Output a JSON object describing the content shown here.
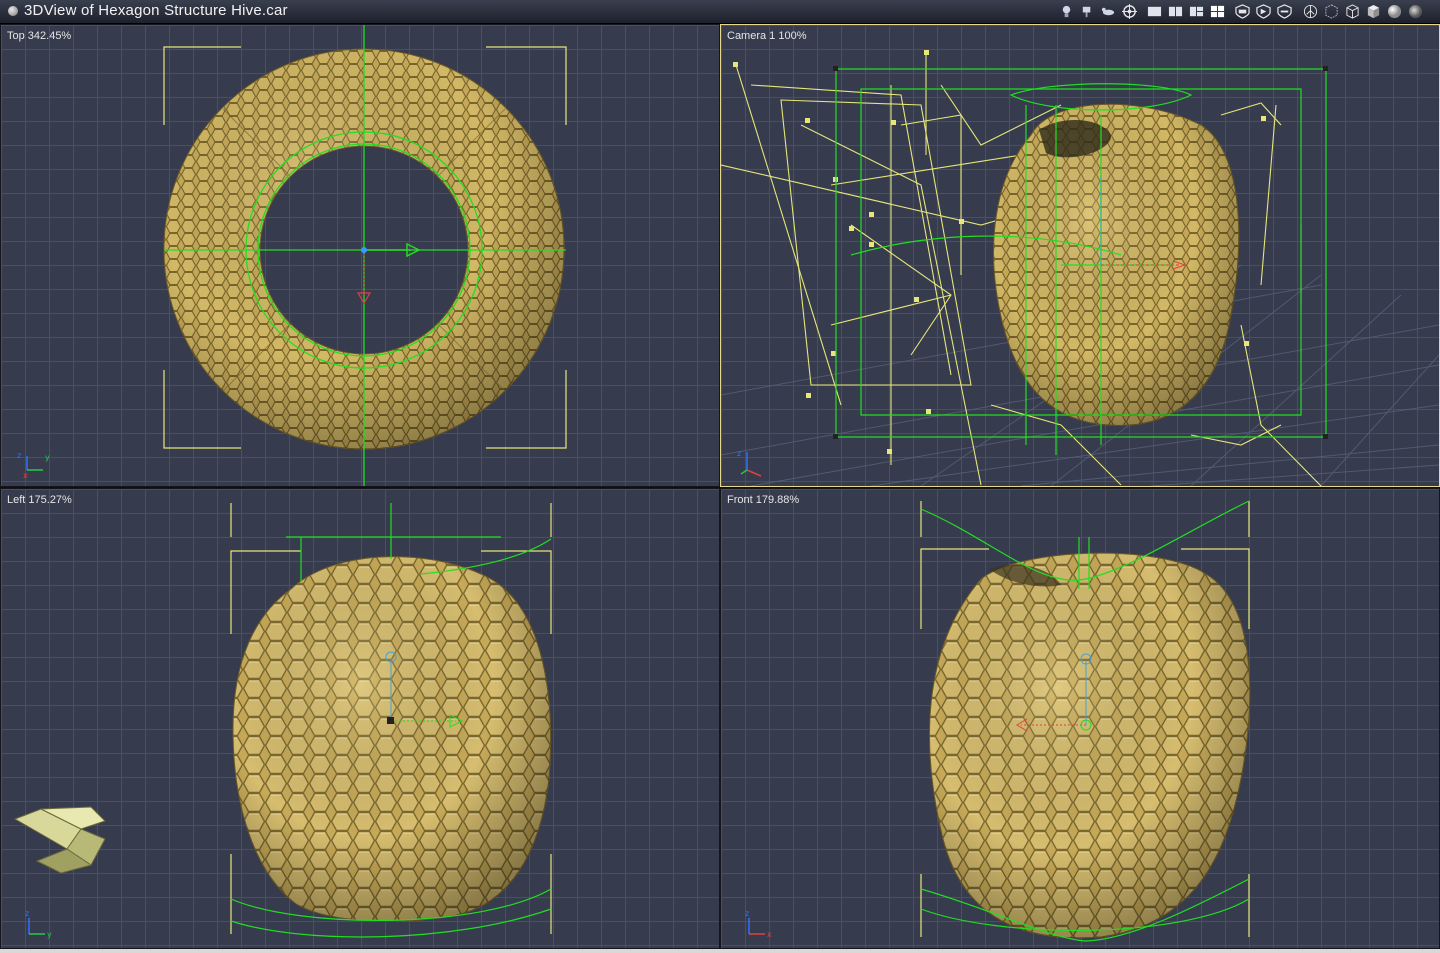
{
  "window": {
    "title": "3DView of Hexagon Structure Hive.car"
  },
  "toolbar": {
    "tool_icons": [
      "light-icon",
      "camera-icon",
      "animal-icon",
      "target-icon"
    ],
    "layout_icons": [
      "layout-single-icon",
      "layout-two-icon",
      "layout-three-icon",
      "layout-four-icon"
    ],
    "view_icons": [
      "shield-front-icon",
      "shield-side-icon",
      "shield-top-icon"
    ],
    "render_icons": [
      "axis-icon",
      "bounding-box-icon",
      "wireframe-cube-icon",
      "solid-cube-icon",
      "smooth-sphere-icon",
      "shaded-sphere-icon"
    ]
  },
  "viewports": {
    "top": {
      "label": "Top 342.45%"
    },
    "camera": {
      "label": "Camera 1 100%"
    },
    "left": {
      "label": "Left 175.27%"
    },
    "front": {
      "label": "Front 179.88%"
    }
  },
  "axes": {
    "x": "x",
    "y": "y",
    "z": "z"
  },
  "colors": {
    "viewport_bg": "#363b4e",
    "grid": "#4a5063",
    "object_fill": "#c9ad5c",
    "selection_green": "#22dd22",
    "bounds_yellow": "#e6e67a",
    "active_border": "#e8d98a"
  }
}
